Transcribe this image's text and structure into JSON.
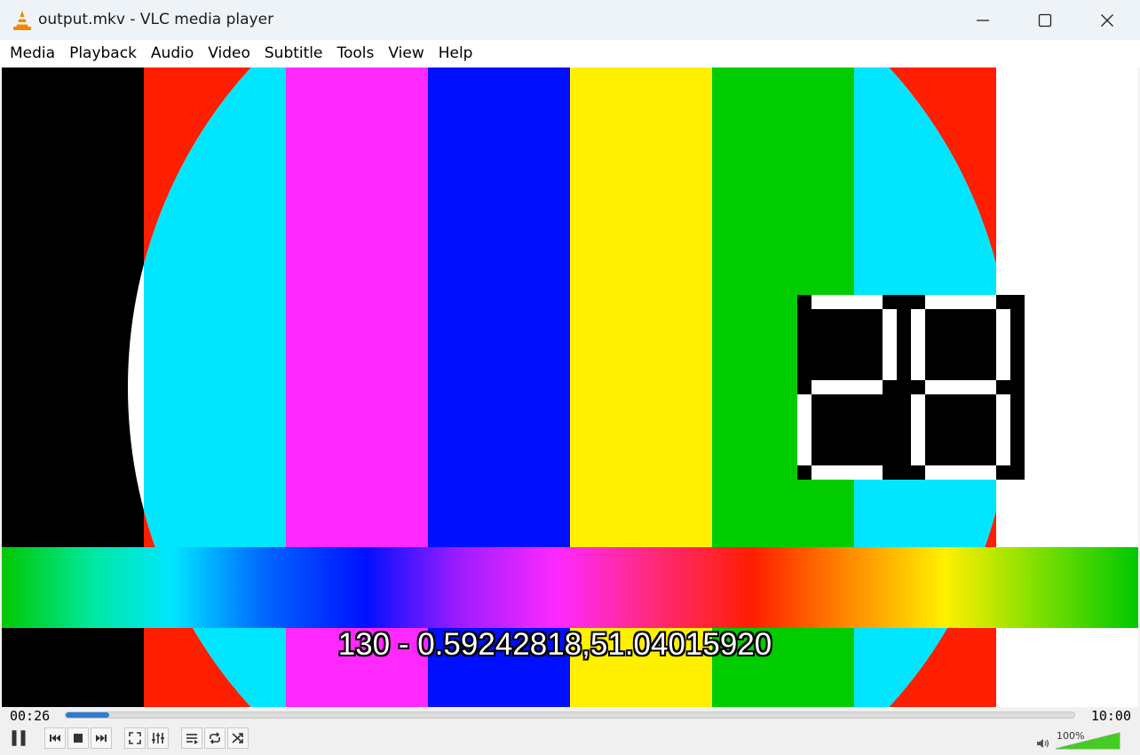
{
  "window": {
    "title": "output.mkv - VLC media player",
    "icons": {
      "app": "vlc-cone-icon",
      "minimize": "minimize-icon",
      "maximize": "maximize-icon",
      "close": "close-icon"
    }
  },
  "menu": [
    "Media",
    "Playback",
    "Audio",
    "Video",
    "Subtitle",
    "Tools",
    "View",
    "Help"
  ],
  "video": {
    "subtitle": "130 - 0.59242818,51.04015920",
    "bar_colors": [
      "#000000",
      "#ff1e00",
      "#ff29ff",
      "#0010ff",
      "#fff000",
      "#00cc00",
      "#ff1e00",
      "#ffffff"
    ],
    "circle_colors": [
      "#000000",
      "#00e6ff",
      "#ff29ff",
      "#0010ff",
      "#fff000",
      "#00cc00",
      "#00e6ff",
      "#000000"
    ]
  },
  "playback": {
    "current_time": "00:26",
    "total_time": "10:00",
    "progress": 0.043,
    "accent": "#2e7bd0"
  },
  "controls": {
    "buttons": [
      "pause-icon",
      "previous-icon",
      "stop-icon",
      "next-icon",
      "fullscreen-icon",
      "extended-settings-icon",
      "playlist-icon",
      "loop-icon",
      "shuffle-icon"
    ]
  },
  "volume": {
    "label": "100%",
    "level": 1.0,
    "icon": "speaker-icon",
    "color": "#44cc22"
  }
}
